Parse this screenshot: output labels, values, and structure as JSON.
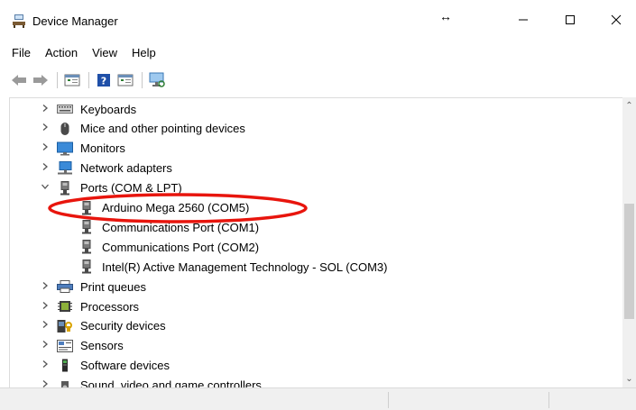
{
  "window": {
    "title": "Device Manager",
    "controls": {
      "minimize": "—",
      "maximize": "☐",
      "close": "✕"
    },
    "cursor": "↔"
  },
  "menu": [
    "File",
    "Action",
    "View",
    "Help"
  ],
  "toolbar": {
    "buttons": [
      "back-icon",
      "forward-icon",
      "properties-icon",
      "help-icon",
      "view-icon",
      "scan-hardware-icon"
    ]
  },
  "tree": {
    "items": [
      {
        "label": "Keyboards",
        "icon": "keyboard-icon",
        "expanded": false,
        "level": 0
      },
      {
        "label": "Mice and other pointing devices",
        "icon": "mouse-icon",
        "expanded": false,
        "level": 0
      },
      {
        "label": "Monitors",
        "icon": "monitor-icon",
        "expanded": false,
        "level": 0
      },
      {
        "label": "Network adapters",
        "icon": "network-icon",
        "expanded": false,
        "level": 0
      },
      {
        "label": "Ports (COM & LPT)",
        "icon": "port-icon",
        "expanded": true,
        "level": 0
      },
      {
        "label": "Arduino Mega 2560 (COM5)",
        "icon": "port-icon",
        "level": 1
      },
      {
        "label": "Communications Port (COM1)",
        "icon": "port-icon",
        "level": 1
      },
      {
        "label": "Communications Port (COM2)",
        "icon": "port-icon",
        "level": 1
      },
      {
        "label": "Intel(R) Active Management Technology - SOL (COM3)",
        "icon": "port-icon",
        "level": 1
      },
      {
        "label": "Print queues",
        "icon": "printer-icon",
        "expanded": false,
        "level": 0
      },
      {
        "label": "Processors",
        "icon": "processor-icon",
        "expanded": false,
        "level": 0
      },
      {
        "label": "Security devices",
        "icon": "security-icon",
        "expanded": false,
        "level": 0
      },
      {
        "label": "Sensors",
        "icon": "sensors-icon",
        "expanded": false,
        "level": 0
      },
      {
        "label": "Software devices",
        "icon": "software-icon",
        "expanded": false,
        "level": 0
      },
      {
        "label": "Sound, video and game controllers",
        "icon": "sound-icon",
        "expanded": false,
        "level": 0
      }
    ]
  },
  "highlight": {
    "color": "#e8150d",
    "target": "Arduino Mega 2560 (COM5)"
  }
}
